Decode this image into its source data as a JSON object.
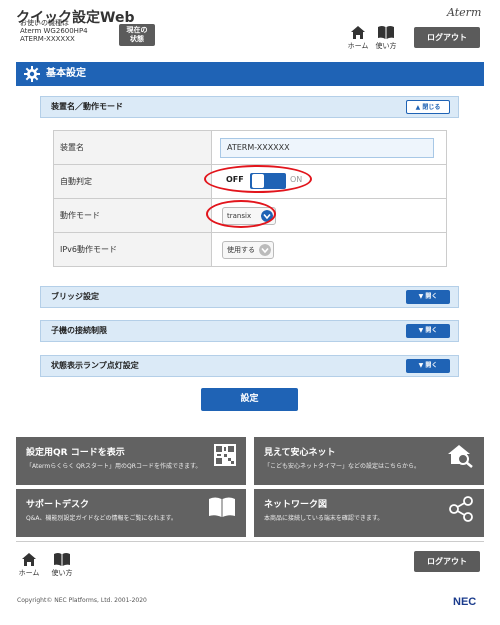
{
  "header": {
    "title": "クイック設定Web",
    "model_caption": "お使いの機種は",
    "model_name": "Aterm WG2600HP4",
    "device_id": "ATERM-XXXXXX",
    "status_button_line1": "現在の",
    "status_button_line2": "状態",
    "logo": "Aterm",
    "nav": {
      "home": "ホーム",
      "help": "使い方"
    },
    "logout_label": "ログアウト"
  },
  "section": {
    "title": "基本設定"
  },
  "device_panel": {
    "title": "装置名／動作モード",
    "close_label": "閉じる",
    "rows": [
      {
        "label": "装置名",
        "value": "ATERM-XXXXXX"
      },
      {
        "label": "自動判定",
        "off_label": "OFF",
        "on_label": "ON",
        "state": "OFF"
      },
      {
        "label": "動作モード",
        "value": "transix"
      },
      {
        "label": "IPv6動作モード",
        "value": "使用する"
      }
    ]
  },
  "collapsed_panels": [
    {
      "title": "ブリッジ設定",
      "open_label": "開く"
    },
    {
      "title": "子機の接続制限",
      "open_label": "開く"
    },
    {
      "title": "状態表示ランプ点灯設定",
      "open_label": "開く"
    }
  ],
  "apply_label": "設定",
  "tiles": [
    {
      "title": "設定用QR コードを表示",
      "desc": "「Atermらくらく QRスタート」用のQRコードを作成できます。",
      "icon": "qr-code-icon"
    },
    {
      "title": "見えて安心ネット",
      "desc": "「こども安心ネットタイマー」などの設定はこちらから。",
      "icon": "house-search-icon"
    },
    {
      "title": "サポートデスク",
      "desc": "Q&A、機能別設定ガイドなどの情報をご覧になれます。",
      "icon": "book-icon"
    },
    {
      "title": "ネットワーク図",
      "desc": "本商品に接続している端末を確認できます。",
      "icon": "network-icon"
    }
  ],
  "footer": {
    "nav": {
      "home": "ホーム",
      "help": "使い方"
    },
    "logout_label": "ログアウト",
    "copyright": "Copyright© NEC Platforms, Ltd. 2001-2020",
    "brand": "NEC"
  },
  "colors": {
    "accent": "#1f63b5",
    "highlight": "#e2151c",
    "tile": "#626262"
  }
}
